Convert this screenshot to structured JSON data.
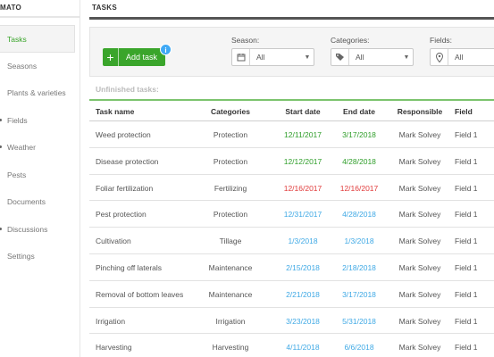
{
  "sidebar": {
    "brand": "MATO",
    "items": [
      {
        "label": "Tasks",
        "active": true
      },
      {
        "label": "Seasons",
        "active": false
      },
      {
        "label": "Plants & varieties",
        "active": false
      },
      {
        "label": "Fields",
        "active": false
      },
      {
        "label": "Weather",
        "active": false
      },
      {
        "label": "Pests",
        "active": false
      },
      {
        "label": "Documents",
        "active": false
      },
      {
        "label": "Discussions",
        "active": false
      },
      {
        "label": "Settings",
        "active": false
      }
    ]
  },
  "header": {
    "title": "TASKS"
  },
  "toolbar": {
    "add_label": "Add task",
    "info_icon": "info-icon",
    "filters": {
      "season": {
        "label": "Season:",
        "value": "All",
        "icon": "calendar-icon"
      },
      "categories": {
        "label": "Categories:",
        "value": "All",
        "icon": "tag-icon"
      },
      "fields": {
        "label": "Fields:",
        "value": "All",
        "icon": "map-pin-icon"
      }
    }
  },
  "section": {
    "label": "Unfinished tasks:"
  },
  "table": {
    "columns": {
      "name": "Task name",
      "categories": "Categories",
      "start": "Start date",
      "end": "End date",
      "responsible": "Responsible",
      "field": "Field"
    },
    "rows": [
      {
        "name": "Weed protection",
        "category": "Protection",
        "start": "12/11/2017",
        "end": "3/17/2018",
        "responsible": "Mark Solvey",
        "field": "Field 1",
        "start_color": "green",
        "end_color": "green"
      },
      {
        "name": "Disease protection",
        "category": "Protection",
        "start": "12/12/2017",
        "end": "4/28/2018",
        "responsible": "Mark Solvey",
        "field": "Field 1",
        "start_color": "green",
        "end_color": "green"
      },
      {
        "name": "Foliar fertilization",
        "category": "Fertilizing",
        "start": "12/16/2017",
        "end": "12/16/2017",
        "responsible": "Mark Solvey",
        "field": "Field 1",
        "start_color": "red",
        "end_color": "red"
      },
      {
        "name": "Pest protection",
        "category": "Protection",
        "start": "12/31/2017",
        "end": "4/28/2018",
        "responsible": "Mark Solvey",
        "field": "Field 1",
        "start_color": "blue",
        "end_color": "blue"
      },
      {
        "name": "Cultivation",
        "category": "Tillage",
        "start": "1/3/2018",
        "end": "1/3/2018",
        "responsible": "Mark Solvey",
        "field": "Field 1",
        "start_color": "blue",
        "end_color": "blue"
      },
      {
        "name": "Pinching off laterals",
        "category": "Maintenance",
        "start": "2/15/2018",
        "end": "2/18/2018",
        "responsible": "Mark Solvey",
        "field": "Field 1",
        "start_color": "blue",
        "end_color": "blue"
      },
      {
        "name": "Removal of bottom leaves",
        "category": "Maintenance",
        "start": "2/21/2018",
        "end": "3/17/2018",
        "responsible": "Mark Solvey",
        "field": "Field 1",
        "start_color": "blue",
        "end_color": "blue"
      },
      {
        "name": "Irrigation",
        "category": "Irrigation",
        "start": "3/23/2018",
        "end": "5/31/2018",
        "responsible": "Mark Solvey",
        "field": "Field 1",
        "start_color": "blue",
        "end_color": "blue"
      },
      {
        "name": "Harvesting",
        "category": "Harvesting",
        "start": "4/11/2018",
        "end": "6/6/2018",
        "responsible": "Mark Solvey",
        "field": "Field 1",
        "start_color": "blue",
        "end_color": "blue"
      }
    ]
  },
  "colors": {
    "accent": "#3aa52b",
    "green": "#2f9e2a",
    "red": "#e03a3a",
    "blue": "#3fa9e5",
    "info": "#3fa9f5"
  }
}
